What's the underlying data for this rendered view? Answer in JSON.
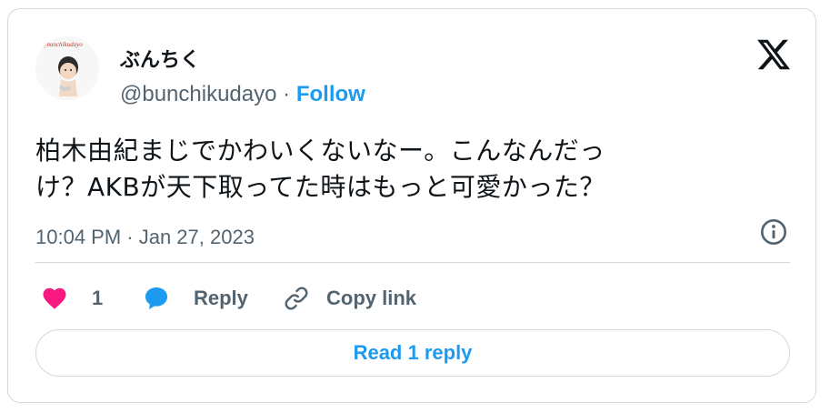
{
  "author": {
    "display_name": "ぶんちく",
    "handle": "@bunchikudayo",
    "separator": "·",
    "follow_label": "Follow",
    "avatar_caption": "@bunchikudayo"
  },
  "tweet": {
    "text_line1": "柏木由紀まじでかわいくないなー。こんなんだっ",
    "text_line2": "け？AKBが天下取ってた時はもっと可愛かった？",
    "timestamp": "10:04 PM · Jan 27, 2023"
  },
  "actions": {
    "like_count": "1",
    "reply_label": "Reply",
    "copy_label": "Copy link",
    "read_replies_label": "Read 1 reply"
  },
  "colors": {
    "accent": "#1d9bf0",
    "like": "#f91880",
    "muted": "#536471",
    "border": "#cfd9de"
  }
}
